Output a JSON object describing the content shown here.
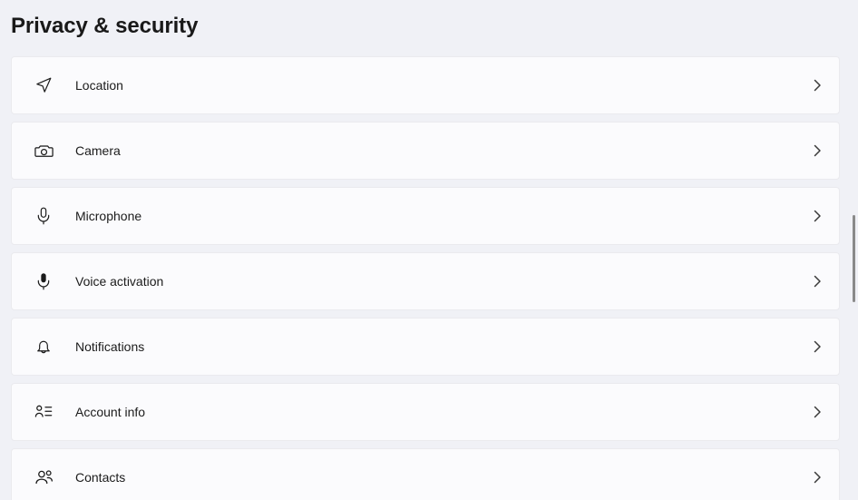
{
  "page": {
    "title": "Privacy & security",
    "background_color": "#f0f1f6",
    "card_color": "#fbfbfd",
    "text_color": "#1b1b1b"
  },
  "settings": {
    "items": [
      {
        "label": "Location",
        "icon": "location-arrow-icon",
        "chevron": "›"
      },
      {
        "label": "Camera",
        "icon": "camera-icon",
        "chevron": "›"
      },
      {
        "label": "Microphone",
        "icon": "microphone-icon",
        "chevron": "›"
      },
      {
        "label": "Voice activation",
        "icon": "voice-activation-icon",
        "chevron": "›"
      },
      {
        "label": "Notifications",
        "icon": "bell-icon",
        "chevron": "›"
      },
      {
        "label": "Account info",
        "icon": "account-info-icon",
        "chevron": "›"
      },
      {
        "label": "Contacts",
        "icon": "contacts-icon",
        "chevron": "›"
      }
    ]
  },
  "scrollbar": {
    "thumb_color": "#8a8a8a",
    "position_percent": 36
  }
}
